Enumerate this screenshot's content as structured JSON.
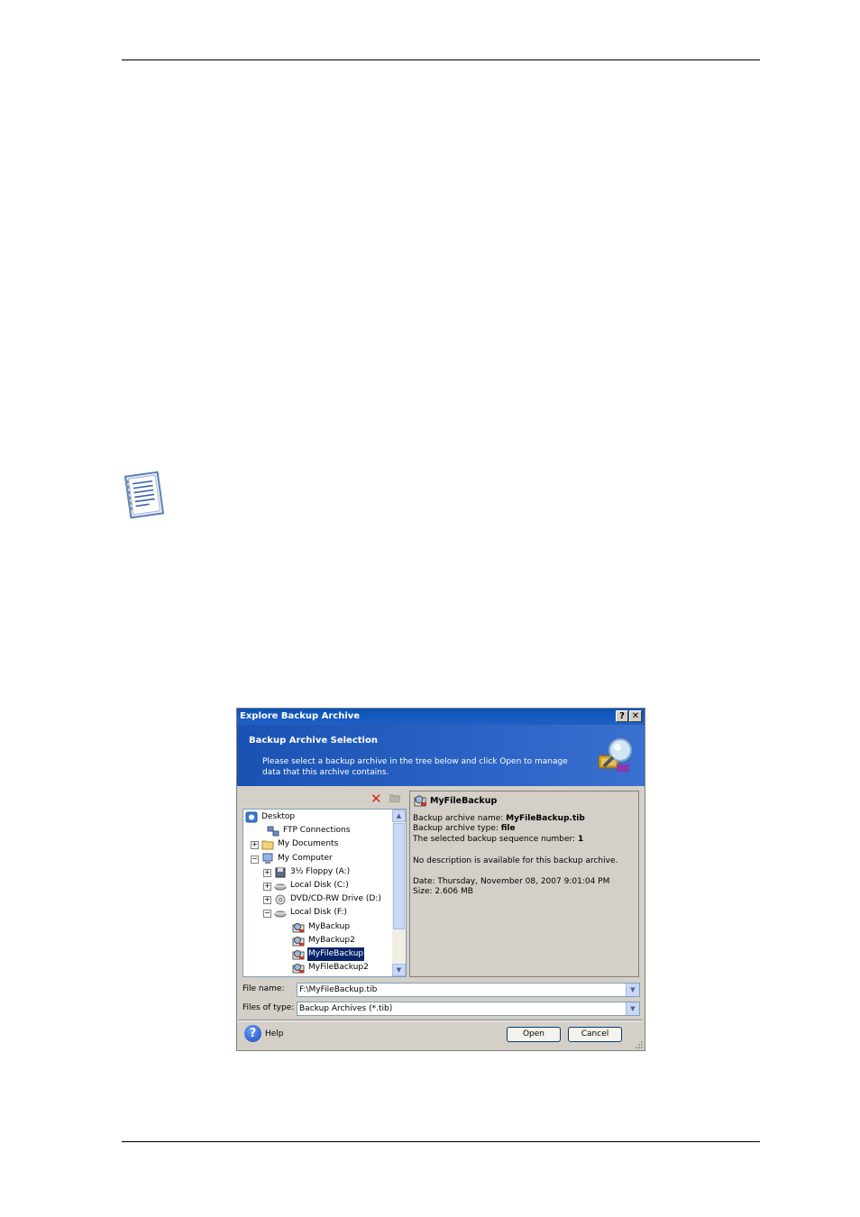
{
  "page": {
    "icons": {
      "note": "note-icon"
    }
  },
  "dialog": {
    "title": "Explore Backup Archive",
    "title_buttons": {
      "help": "?",
      "close": "✕"
    },
    "banner": {
      "title": "Backup Archive Selection",
      "description": "Please select a backup archive in the tree below and click Open to manage data that this archive contains.",
      "icon": "archive-magnifier-icon"
    },
    "toolbar": {
      "delete_icon": "delete-icon",
      "new_folder_icon": "new-folder-icon"
    },
    "tree": [
      {
        "label": "Desktop",
        "icon": "desktop-icon",
        "expander": ""
      },
      {
        "label": "FTP Connections",
        "icon": "ftp-icon",
        "expander": ""
      },
      {
        "label": "My Documents",
        "icon": "folder-icon",
        "expander": "+"
      },
      {
        "label": "My Computer",
        "icon": "computer-icon",
        "expander": "−"
      },
      {
        "label": "3½ Floppy (A:)",
        "icon": "floppy-icon",
        "expander": "+"
      },
      {
        "label": "Local Disk (C:)",
        "icon": "disk-icon",
        "expander": "+"
      },
      {
        "label": "DVD/CD-RW Drive (D:)",
        "icon": "cdrom-icon",
        "expander": "+"
      },
      {
        "label": "Local Disk (F:)",
        "icon": "disk-icon",
        "expander": "−"
      },
      {
        "label": "MyBackup",
        "icon": "archive-icon",
        "expander": ""
      },
      {
        "label": "MyBackup2",
        "icon": "archive-icon",
        "expander": ""
      },
      {
        "label": "MyFileBackup",
        "icon": "archive-icon",
        "expander": "",
        "selected": true
      },
      {
        "label": "MyFileBackup2",
        "icon": "archive-icon",
        "expander": ""
      }
    ],
    "info": {
      "title": "MyFileBackup",
      "name_label": "Backup archive name: ",
      "name_value": "MyFileBackup.tib",
      "type_label": "Backup archive type: ",
      "type_value": "file",
      "seq_label": "The selected backup sequence number: ",
      "seq_value": "1",
      "description": "No description is available for this backup archive.",
      "date": "Date: Thursday, November 08, 2007 9:01:04 PM",
      "size": "Size: 2.606 MB"
    },
    "file_name_label": "File name:",
    "file_name_value": "F:\\MyFileBackup.tib",
    "file_type_label": "Files of type:",
    "file_type_value": "Backup Archives (*.tib)",
    "help_label": "Help",
    "open_label": "Open",
    "cancel_label": "Cancel"
  }
}
